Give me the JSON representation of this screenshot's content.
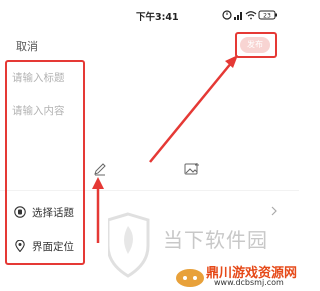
{
  "status_bar": {
    "time": "下午3:41",
    "icons": [
      "alarm-icon",
      "signal-icon",
      "wifi-icon",
      "battery-icon"
    ],
    "battery_level": "23"
  },
  "top_bar": {
    "cancel_label": "取消",
    "publish_label": "发布"
  },
  "editor": {
    "title_placeholder": "请输入标题",
    "content_placeholder": "请输入内容",
    "tools": [
      "pen-icon",
      "image-icon"
    ]
  },
  "options": {
    "topic_label": "选择话题",
    "location_label": "界面定位"
  },
  "annotations": {
    "highlight_color": "#e53935"
  },
  "watermark": {
    "main_text": "当下软件园",
    "brand_text": "鼎川游戏资源网",
    "url_text": "www.dcbsmj.com"
  }
}
